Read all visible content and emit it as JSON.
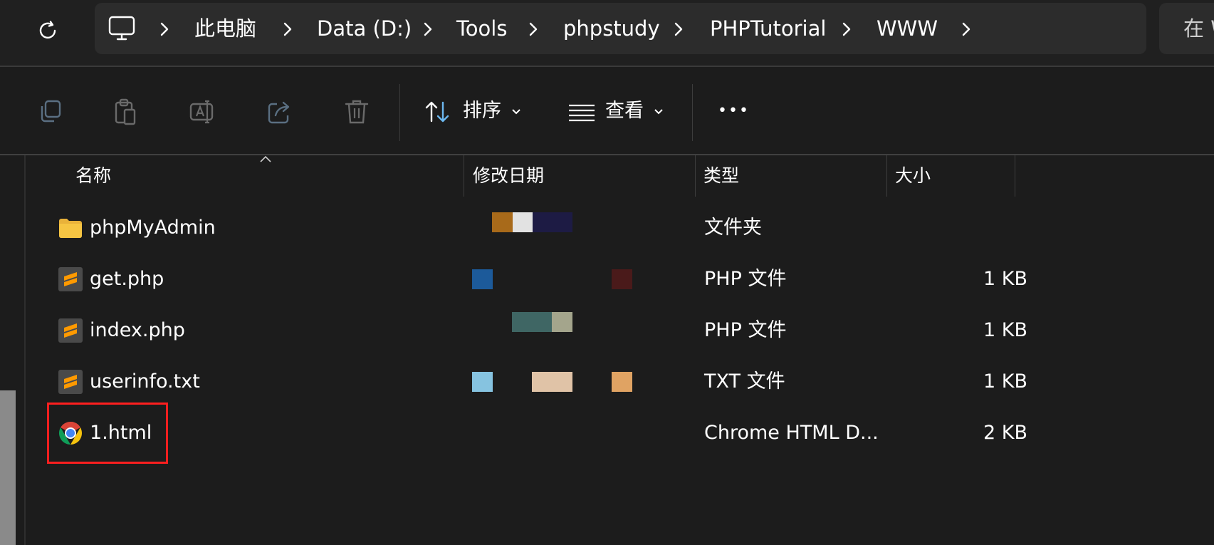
{
  "address_bar": {
    "breadcrumbs": [
      "此电脑",
      "Data (D:)",
      "Tools",
      "phpstudy",
      "PHPTutorial",
      "WWW"
    ],
    "search_prefix": "在 W"
  },
  "toolbar": {
    "sort_label": "排序",
    "view_label": "查看",
    "more_label": "•••"
  },
  "columns": {
    "name": "名称",
    "modified": "修改日期",
    "type": "类型",
    "size": "大小"
  },
  "files": [
    {
      "name": "phpMyAdmin",
      "type": "文件夹",
      "size": "",
      "icon": "folder-icon"
    },
    {
      "name": "get.php",
      "type": "PHP 文件",
      "size": "1 KB",
      "icon": "sublime-file-icon"
    },
    {
      "name": "index.php",
      "type": "PHP 文件",
      "size": "1 KB",
      "icon": "sublime-file-icon"
    },
    {
      "name": "userinfo.txt",
      "type": "TXT 文件",
      "size": "1 KB",
      "icon": "sublime-file-icon"
    },
    {
      "name": "1.html",
      "type": "Chrome HTML D...",
      "size": "2 KB",
      "icon": "chrome-icon"
    }
  ],
  "colors": {
    "background": "#1c1c1c",
    "address_bar": "#2c2c2c",
    "highlight": "#ff1f1f",
    "folder": "#f6c543",
    "sublime": "#ff9a00"
  }
}
